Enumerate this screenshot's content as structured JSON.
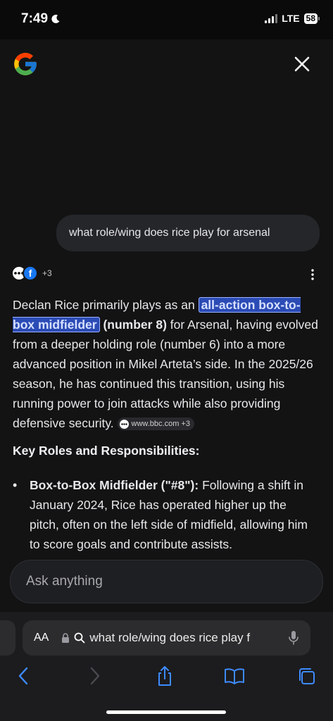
{
  "status_bar": {
    "time": "7:49",
    "network": "LTE",
    "battery": "58"
  },
  "header": {
    "logo_icon": "google-g-icon",
    "close_icon": "close-icon"
  },
  "query": {
    "text": "what role/wing does rice play for arsenal"
  },
  "sources": {
    "count_label": "+3",
    "icons": [
      "more-dots-source-icon",
      "facebook-icon"
    ]
  },
  "answer": {
    "part1": "Declan Rice primarily plays as an ",
    "highlight": "all-action box-to-box midfielder",
    "bold": " (number 8)",
    "part2": " for Arsenal, having evolved from a deeper holding role (number 6) into a more advanced position in Mikel Arteta’s side. In the 2025/26 season, he has continued this transition, using his running power to join attacks while also providing defensive security.",
    "citation": "www.bbc.com +3"
  },
  "section": {
    "heading": "Key Roles and Responsibilities:",
    "bullets": [
      {
        "title": "Box-to-Box Midfielder (\"#8\"):",
        "text": " Following a shift in January 2024, Rice has operated higher up the pitch, often on the left side of midfield, allowing him to score goals and contribute assists."
      }
    ]
  },
  "ask": {
    "placeholder": "Ask anything"
  },
  "safari": {
    "aa_label": "AA",
    "url_text": "what role/wing does rice play f",
    "toolbar_icons": [
      "back-icon",
      "forward-icon",
      "share-icon",
      "bookmarks-icon",
      "tabs-icon"
    ]
  }
}
